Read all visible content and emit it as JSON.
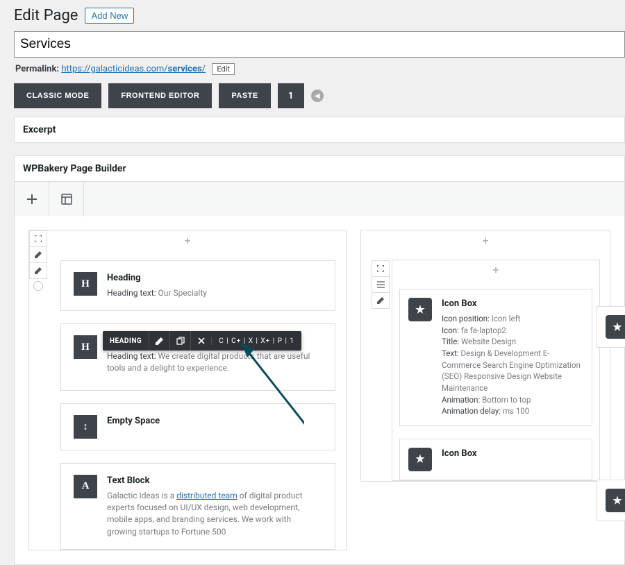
{
  "header": {
    "title": "Edit Page",
    "add_new": "Add New"
  },
  "title_field": {
    "value": "Services"
  },
  "permalink": {
    "label": "Permalink:",
    "url_base": "https://galacticideas.com/",
    "slug": "services",
    "trail": "/",
    "edit": "Edit"
  },
  "modes": {
    "classic": "Classic Mode",
    "frontend": "Frontend Editor",
    "paste": "Paste",
    "count": "1"
  },
  "panels": {
    "excerpt": "Excerpt",
    "builder": "WPBakery Page Builder"
  },
  "toolbar_icons": {
    "add": "plus-icon",
    "layout": "layout-icon"
  },
  "left_column": {
    "controls": {
      "fullscreen": "fullscreen-icon",
      "pencil1": "pencil-icon",
      "pencil2": "pencil-icon"
    },
    "elements": [
      {
        "icon": "H",
        "title": "Heading",
        "lines": [
          {
            "label": "Heading text:",
            "value": " Our Specialty"
          }
        ]
      },
      {
        "icon": "H",
        "title": "Heading",
        "lines": [
          {
            "label": "Heading text:",
            "value": " We create digital products that are useful tools and a delight to experience."
          }
        ],
        "has_toolbar": true
      },
      {
        "icon": "↕",
        "title": "Empty Space",
        "lines": []
      },
      {
        "icon": "A",
        "title": "Text Block",
        "richtext": {
          "prefix": "Galactic Ideas is a ",
          "link": "distributed team",
          "suffix": " of digital product experts focused on UI/UX design, web development, mobile apps, and branding services. We work with growing startups to Fortune 500"
        }
      }
    ]
  },
  "element_toolbar": {
    "label": "HEADING",
    "extra": "C | C+ | X | X+ | P | 1"
  },
  "right_column": {
    "inner_controls": {
      "fullscreen": "fullscreen-icon",
      "list": "list-icon",
      "pencil": "pencil-icon"
    },
    "iconbox": {
      "title": "Icon Box",
      "rows": [
        {
          "label": "Icon position:",
          "value": " Icon left"
        },
        {
          "label": "Icon:",
          "value": " fa fa-laptop2"
        },
        {
          "label": "Title:",
          "value": " Website Design"
        },
        {
          "label": "Text:",
          "value": " Design & Development E-Commerce Search Engine Optimization (SEO) Responsive Design Website Maintenance"
        },
        {
          "label": "Animation:",
          "value": " Bottom to top"
        },
        {
          "label": "Animation delay:",
          "value": " ms 100"
        }
      ]
    },
    "iconbox2": {
      "title": "Icon Box"
    }
  }
}
